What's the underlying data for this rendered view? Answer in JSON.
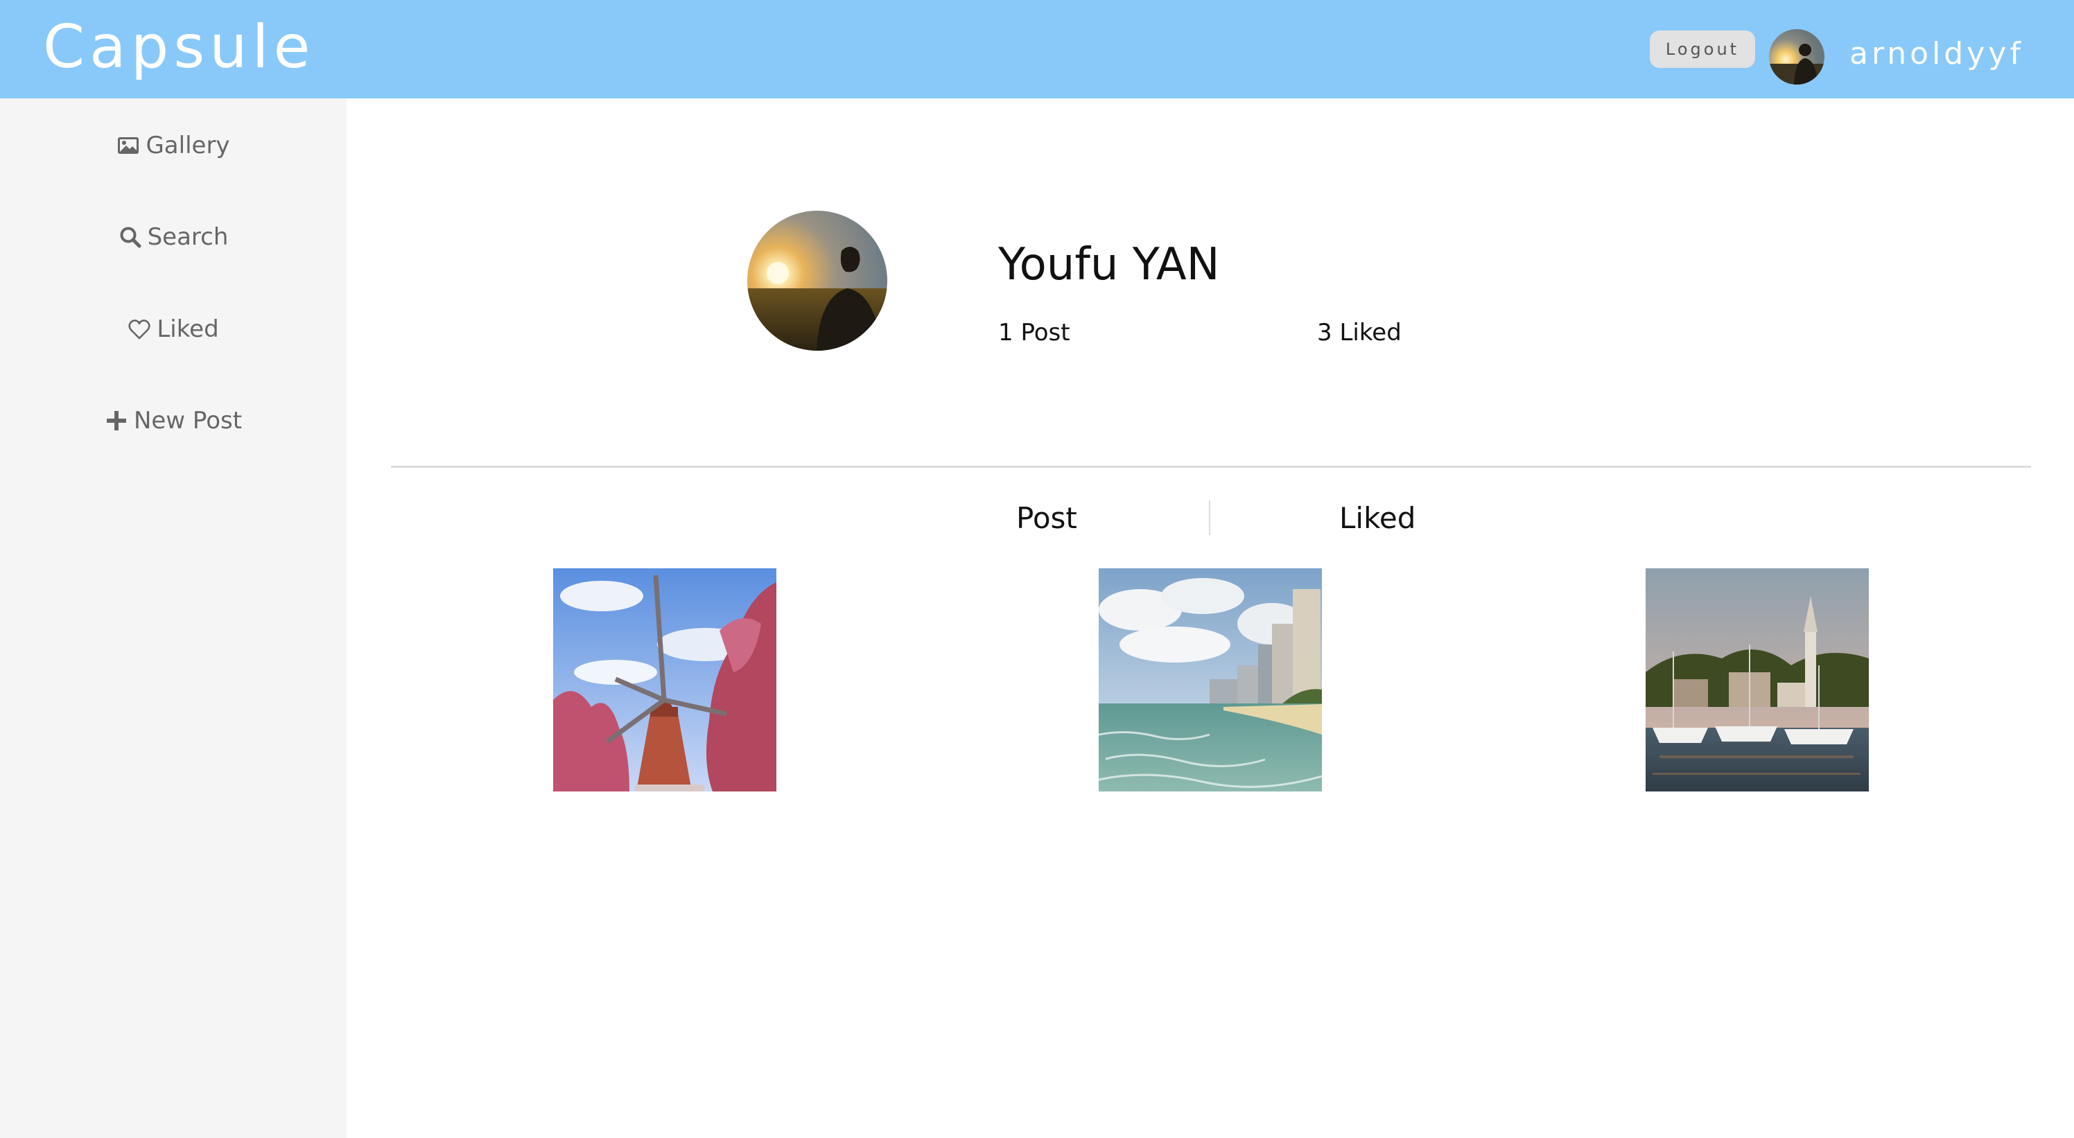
{
  "header": {
    "brand": "Capsule",
    "logout_label": "Logout",
    "username": "arnoldyyf",
    "avatar_icon": "user-avatar-photo"
  },
  "sidebar": {
    "items": [
      {
        "label": "Gallery",
        "icon": "image-icon"
      },
      {
        "label": "Search",
        "icon": "search-icon"
      },
      {
        "label": "Liked",
        "icon": "heart-icon"
      },
      {
        "label": "New Post",
        "icon": "plus-icon"
      }
    ]
  },
  "profile": {
    "name": "Youfu YAN",
    "posts_stat": "1 Post",
    "liked_stat": "3 Liked"
  },
  "tabs": {
    "post_label": "Post",
    "liked_label": "Liked"
  },
  "gallery": [
    {
      "subject": "windmill with pink trees"
    },
    {
      "subject": "beach with skyline"
    },
    {
      "subject": "marina with boats and church"
    }
  ],
  "colors": {
    "header_bg": "#89c9f9",
    "sidebar_bg": "#f5f5f5"
  }
}
